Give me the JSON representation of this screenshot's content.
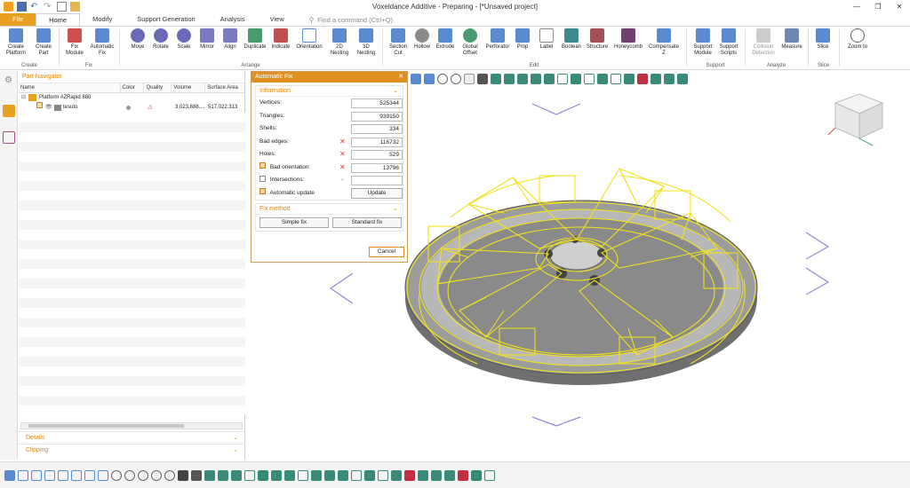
{
  "window": {
    "title": "Voxeldance Additive - Preparing - [*Unsaved project]",
    "controls": [
      "—",
      "❐",
      "✕"
    ]
  },
  "tabs": {
    "file": "File",
    "home": "Home",
    "modify": "Modify",
    "support_generation": "Support Generation",
    "analysis": "Analysis",
    "view": "View",
    "find_placeholder": "Find a command (Ctrl+Q)"
  },
  "ribbon": {
    "create_platform": "Create Platform",
    "create_part": "Create Part",
    "fix_module": "Fix Module",
    "automatic_fix": "Automatic Fix",
    "move": "Move",
    "rotate": "Rotate",
    "scale": "Scale",
    "mirror": "Mirror",
    "align": "Align",
    "duplicate": "Duplicate",
    "indicate": "Indicate",
    "orientation": "Orientation",
    "nesting_2d": "2D Nesting",
    "nesting_3d": "3D Nesting",
    "section_cut": "Section Cut",
    "hollow": "Hollow",
    "extrude": "Extrude",
    "global_offset": "Global Offset",
    "perforator": "Perforator",
    "prop": "Prop",
    "label": "Label",
    "boolean": "Boolean",
    "structure": "Structure",
    "honeycomb": "Honeycomb",
    "compensate_z": "Compensate Z",
    "support_module": "Support Module",
    "support_scripts": "Support Scripts",
    "collision_detection": "Collision Detection",
    "measure": "Measure",
    "slice": "Slice",
    "zoom_to": "Zoom to",
    "groups": {
      "create": "Create",
      "fix": "Fix",
      "arrange": "Arrange",
      "edit": "Edit",
      "support": "Support",
      "analyze": "Analyze",
      "slice": "Slice"
    }
  },
  "part_navigator": {
    "title": "Part Navigator",
    "columns": [
      "Name",
      "Color",
      "Quality",
      "Volume",
      "Surface Area"
    ],
    "platform": "Platform #ZRapid 880",
    "part_name": "tesuto",
    "part_volume": "3,023,688....",
    "part_surface": "517,022.313",
    "details": "Details",
    "clipping": "Clipping"
  },
  "auto_fix": {
    "title": "Automatic Fix",
    "information": "Information",
    "fields": {
      "vertices_label": "Vertices:",
      "vertices": "525344",
      "triangles_label": "Triangles:",
      "triangles": "939150",
      "shells_label": "Shells:",
      "shells": "334",
      "bad_edges_label": "Bad edges:",
      "bad_edges": "116732",
      "holes_label": "Holes:",
      "holes": "529",
      "bad_orientation_label": "Bad orientation:",
      "bad_orientation": "13796",
      "intersections_label": "Intersections:",
      "intersections": "",
      "automatic_update_label": "Automatic update"
    },
    "update": "Update",
    "fix_method": "Fix method",
    "simple_fix": "Simple fix",
    "standard_fix": "Standard fix",
    "cancel": "Cancel"
  },
  "colors": {
    "accent": "#e09020",
    "wireframe": "#f0e020",
    "model": "#9a9a9a"
  }
}
